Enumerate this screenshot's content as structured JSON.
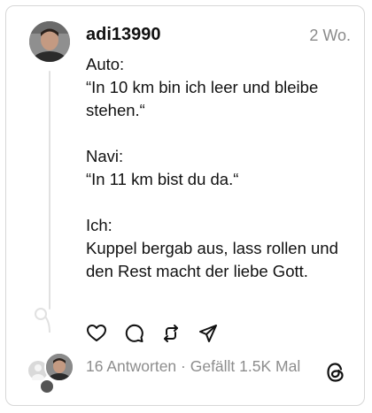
{
  "post": {
    "username": "adi13990",
    "time": "2 Wo.",
    "text": "Auto:\n“In 10 km bin ich leer und bleibe stehen.“\n\nNavi:\n“In 11 km bist du da.“\n\nIch:\nKuppel bergab aus, lass rollen und den Rest macht der liebe Gott."
  },
  "actions": [
    "heart-icon",
    "comment-icon",
    "repost-icon",
    "share-icon"
  ],
  "footer": {
    "replies": "16 Antworten",
    "separator": " · ",
    "likes": "Gefällt 1.5K Mal"
  },
  "icons": {
    "brand": "threads-icon"
  }
}
